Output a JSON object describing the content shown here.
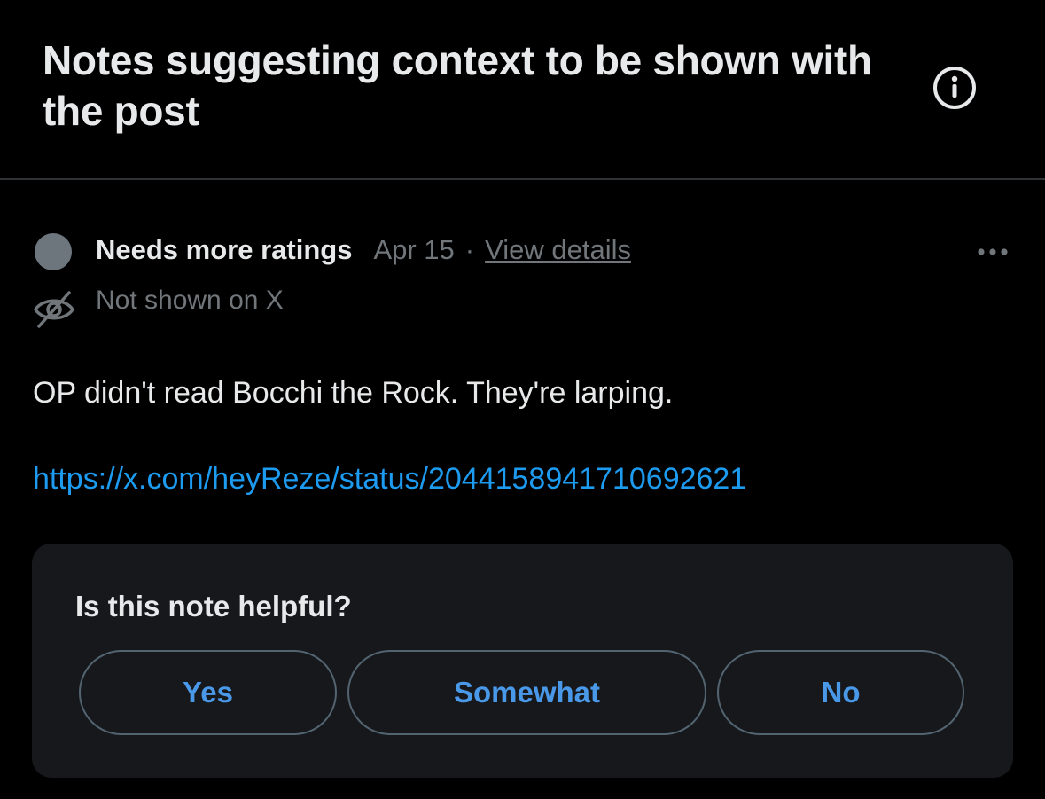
{
  "header": {
    "title": "Notes suggesting context to be shown with the post",
    "info_icon": "info-circle-icon"
  },
  "note": {
    "status_label": "Needs more ratings",
    "date": "Apr 15",
    "separator": "·",
    "view_details": "View details",
    "more_icon": "more-horizontal-icon",
    "visibility_icon": "eye-off-icon",
    "visibility_text": "Not shown on X",
    "body": "OP didn't read Bocchi the Rock. They're larping.",
    "link": "https://x.com/heyReze/status/2044158941710692621",
    "colors": {
      "link": "#1d9bf0",
      "button_text": "#4a99e9",
      "status_dot": "#6e767d"
    }
  },
  "rating": {
    "question": "Is this note helpful?",
    "options": [
      "Yes",
      "Somewhat",
      "No"
    ]
  }
}
